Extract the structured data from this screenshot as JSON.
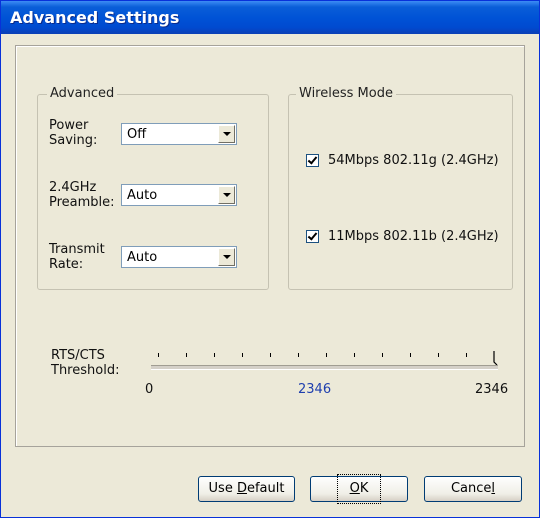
{
  "window": {
    "title": "Advanced Settings"
  },
  "advanced_group": {
    "title": "Advanced",
    "power_saving": {
      "label_line1": "Power",
      "label_line2": "Saving:",
      "value": "Off"
    },
    "preamble": {
      "label_line1": "2.4GHz",
      "label_line2": "Preamble:",
      "value": "Auto"
    },
    "transmit_rate": {
      "label_line1": "Transmit",
      "label_line2": "Rate:",
      "value": "Auto"
    }
  },
  "wireless_mode_group": {
    "title": "Wireless Mode",
    "options": [
      {
        "label": "54Mbps 802.11g (2.4GHz)",
        "checked": true
      },
      {
        "label": "11Mbps 802.11b (2.4GHz)",
        "checked": true
      }
    ]
  },
  "rts_cts": {
    "label_line1": "RTS/CTS",
    "label_line2": "Threshold:",
    "min": "0",
    "current": "2346",
    "max": "2346",
    "current_color": "#1f3fae"
  },
  "buttons": {
    "use_default": {
      "pre": "Use ",
      "accel": "D",
      "post": "efault"
    },
    "ok": {
      "pre": "",
      "accel": "O",
      "post": "K"
    },
    "cancel": {
      "pre": "Cance",
      "accel": "l",
      "post": ""
    }
  },
  "icons": {
    "dropdown": "chevron-down-icon",
    "checkbox": "checkmark-icon"
  }
}
